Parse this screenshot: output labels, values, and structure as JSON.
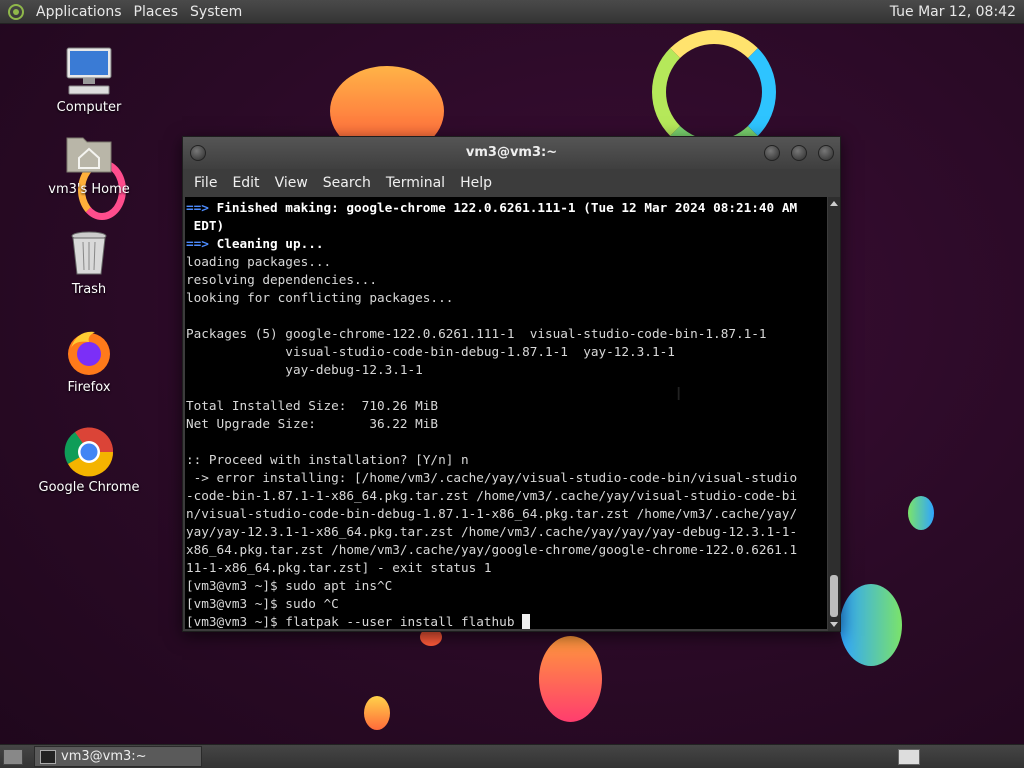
{
  "top_panel": {
    "menus": [
      "Applications",
      "Places",
      "System"
    ],
    "clock": "Tue Mar 12, 08:42"
  },
  "desktop_icons": [
    {
      "label": "Computer",
      "icon": "computer-icon"
    },
    {
      "label": "vm3's Home",
      "icon": "home-folder-icon"
    },
    {
      "label": "Trash",
      "icon": "trash-icon"
    },
    {
      "label": "Firefox",
      "icon": "firefox-icon"
    },
    {
      "label": "Google Chrome",
      "icon": "chrome-icon"
    }
  ],
  "window": {
    "title": "vm3@vm3:~",
    "menu": [
      "File",
      "Edit",
      "View",
      "Search",
      "Terminal",
      "Help"
    ]
  },
  "terminal": {
    "lines": [
      {
        "parts": [
          {
            "t": "==> ",
            "c": "arrow"
          },
          {
            "t": "Finished making: google-chrome 122.0.6261.111-1 (Tue 12 Mar 2024 08:21:40 AM",
            "c": "b"
          }
        ]
      },
      {
        "parts": [
          {
            "t": " EDT)",
            "c": "b"
          }
        ]
      },
      {
        "parts": [
          {
            "t": "==> ",
            "c": "arrow"
          },
          {
            "t": "Cleaning up...",
            "c": "b"
          }
        ]
      },
      {
        "parts": [
          {
            "t": "loading packages...",
            "c": ""
          }
        ]
      },
      {
        "parts": [
          {
            "t": "resolving dependencies...",
            "c": ""
          }
        ]
      },
      {
        "parts": [
          {
            "t": "looking for conflicting packages...",
            "c": ""
          }
        ]
      },
      {
        "parts": [
          {
            "t": "",
            "c": ""
          }
        ]
      },
      {
        "parts": [
          {
            "t": "Packages (5) google-chrome-122.0.6261.111-1  visual-studio-code-bin-1.87.1-1",
            "c": ""
          }
        ]
      },
      {
        "parts": [
          {
            "t": "             visual-studio-code-bin-debug-1.87.1-1  yay-12.3.1-1",
            "c": ""
          }
        ]
      },
      {
        "parts": [
          {
            "t": "             yay-debug-12.3.1-1",
            "c": ""
          }
        ]
      },
      {
        "parts": [
          {
            "t": "",
            "c": ""
          }
        ]
      },
      {
        "parts": [
          {
            "t": "Total Installed Size:  710.26 MiB",
            "c": ""
          }
        ]
      },
      {
        "parts": [
          {
            "t": "Net Upgrade Size:       36.22 MiB",
            "c": ""
          }
        ]
      },
      {
        "parts": [
          {
            "t": "",
            "c": ""
          }
        ]
      },
      {
        "parts": [
          {
            "t": ":: Proceed with installation? [Y/n] n",
            "c": ""
          }
        ]
      },
      {
        "parts": [
          {
            "t": " -> error installing: [/home/vm3/.cache/yay/visual-studio-code-bin/visual-studio",
            "c": ""
          }
        ]
      },
      {
        "parts": [
          {
            "t": "-code-bin-1.87.1-1-x86_64.pkg.tar.zst /home/vm3/.cache/yay/visual-studio-code-bi",
            "c": ""
          }
        ]
      },
      {
        "parts": [
          {
            "t": "n/visual-studio-code-bin-debug-1.87.1-1-x86_64.pkg.tar.zst /home/vm3/.cache/yay/",
            "c": ""
          }
        ]
      },
      {
        "parts": [
          {
            "t": "yay/yay-12.3.1-1-x86_64.pkg.tar.zst /home/vm3/.cache/yay/yay/yay-debug-12.3.1-1-",
            "c": ""
          }
        ]
      },
      {
        "parts": [
          {
            "t": "x86_64.pkg.tar.zst /home/vm3/.cache/yay/google-chrome/google-chrome-122.0.6261.1",
            "c": ""
          }
        ]
      },
      {
        "parts": [
          {
            "t": "11-1-x86_64.pkg.tar.zst] - exit status 1",
            "c": ""
          }
        ]
      },
      {
        "parts": [
          {
            "t": "[vm3@vm3 ~]$ sudo apt ins^C",
            "c": ""
          }
        ]
      },
      {
        "parts": [
          {
            "t": "[vm3@vm3 ~]$ sudo ^C",
            "c": ""
          }
        ]
      },
      {
        "parts": [
          {
            "t": "[vm3@vm3 ~]$ flatpak --user install flathub ",
            "c": ""
          }
        ]
      }
    ]
  },
  "taskbar": {
    "task_label": "vm3@vm3:~"
  }
}
